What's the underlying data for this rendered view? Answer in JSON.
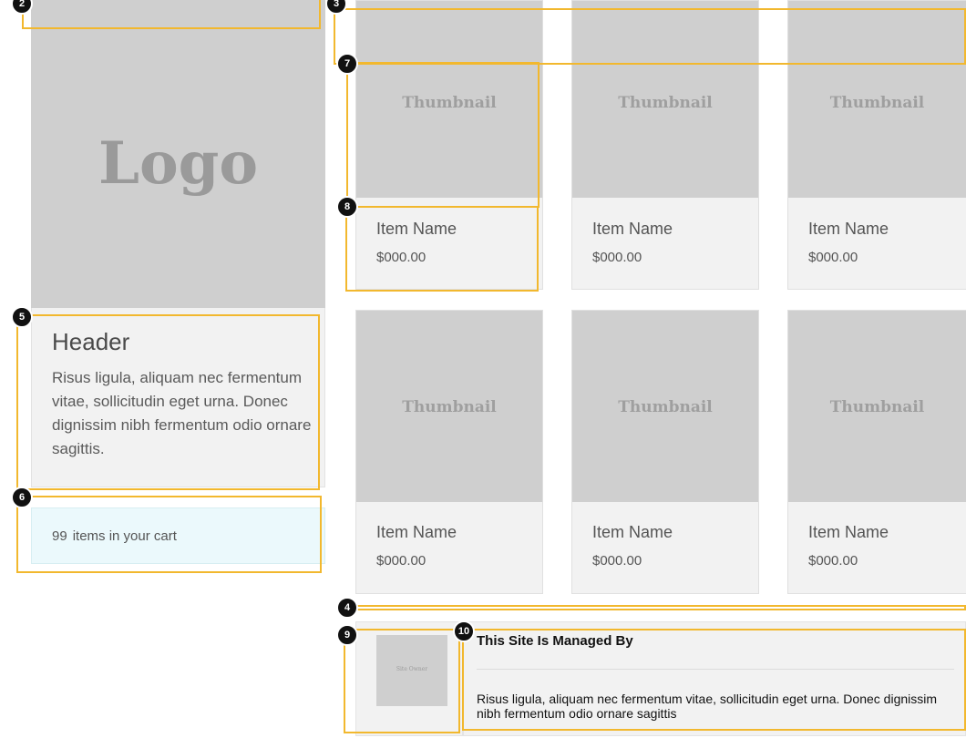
{
  "logo": {
    "text": "Logo"
  },
  "sidebar": {
    "header_title": "Header",
    "header_body": "Risus ligula, aliquam nec fermentum vitae, sollicitudin eget urna. Donec dignissim nibh fermentum odio ornare sagittis.",
    "cart_count": "99",
    "cart_label": "items in your cart"
  },
  "products": [
    {
      "thumb": "Thumbnail",
      "name": "Item Name",
      "price": "$000.00"
    },
    {
      "thumb": "Thumbnail",
      "name": "Item Name",
      "price": "$000.00"
    },
    {
      "thumb": "Thumbnail",
      "name": "Item Name",
      "price": "$000.00"
    },
    {
      "thumb": "Thumbnail",
      "name": "Item Name",
      "price": "$000.00"
    },
    {
      "thumb": "Thumbnail",
      "name": "Item Name",
      "price": "$000.00"
    },
    {
      "thumb": "Thumbnail",
      "name": "Item Name",
      "price": "$000.00"
    }
  ],
  "footer": {
    "owner_thumb_label": "Site Owner",
    "title": "This Site Is Managed By",
    "body": "Risus ligula, aliquam nec fermentum vitae, sollicitudin eget urna. Donec dignissim nibh fermentum odio ornare sagittis"
  },
  "annotations": {
    "badges": [
      "2",
      "3",
      "4",
      "5",
      "6",
      "7",
      "8",
      "9",
      "10"
    ]
  },
  "colors": {
    "annotation": "#f2b82e",
    "placeholder": "#cfcfcf",
    "card_bg": "#f2f2f2",
    "cart_bg": "#ebf9fc"
  }
}
